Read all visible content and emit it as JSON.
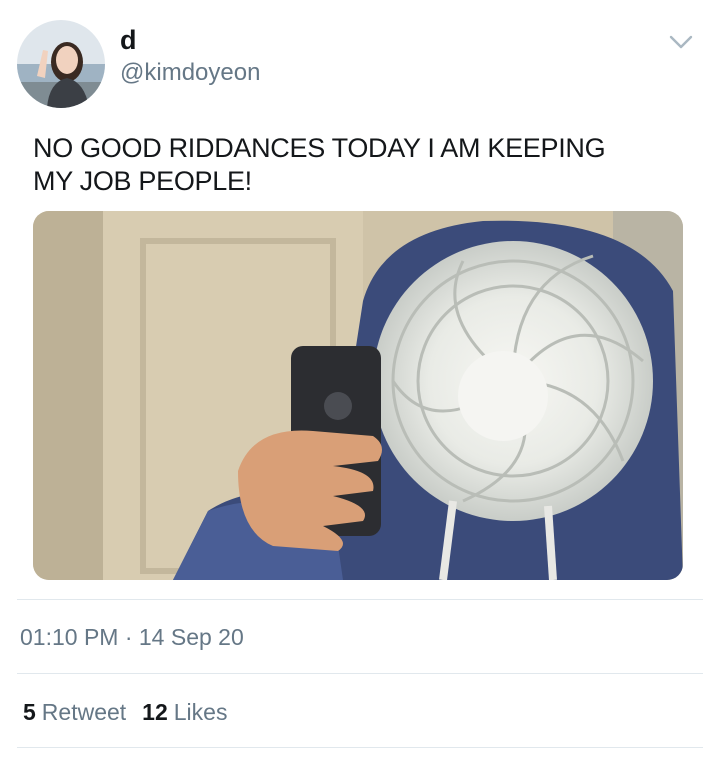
{
  "user": {
    "display_name": "d",
    "handle": "@kimdoyeon",
    "avatar_icon": "profile-photo"
  },
  "menu": {
    "icon": "chevron-down-icon"
  },
  "tweet": {
    "text": "NO GOOD RIDDANCES TODAY I AM KEEPING\nMY JOB PEOPLE!",
    "media_icon": "photo-person-holding-fan-with-phone"
  },
  "meta": {
    "timestamp": "01:10 PM · 14 Sep 20"
  },
  "stats": {
    "retweets_count": "5",
    "retweets_label": "Retweet",
    "likes_count": "12",
    "likes_label": "Likes"
  },
  "colors": {
    "text_primary": "#14171a",
    "text_secondary": "#657786",
    "divider": "#e1e8ed"
  }
}
